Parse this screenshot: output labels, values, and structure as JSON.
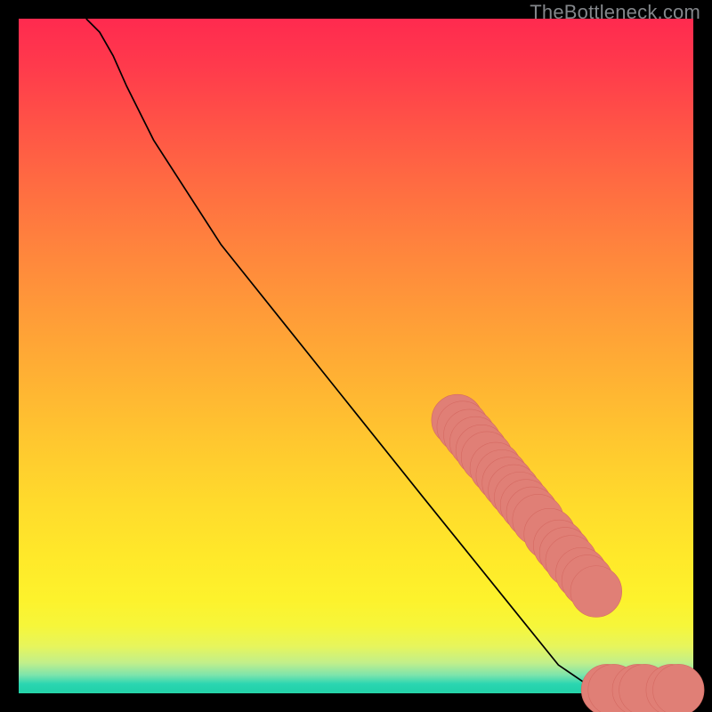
{
  "watermark": "TheBottleneck.com",
  "colors": {
    "curve_stroke": "#000000",
    "marker_fill": "#e07f76",
    "marker_stroke": "#d56a62"
  },
  "chart_data": {
    "type": "line",
    "title": "",
    "xlabel": "",
    "ylabel": "",
    "xlim": [
      0,
      100
    ],
    "ylim": [
      0,
      100
    ],
    "series": [
      {
        "name": "curve",
        "x": [
          10,
          12,
          14,
          16,
          20,
          30,
          40,
          50,
          60,
          65,
          70,
          75,
          80,
          85,
          87,
          89,
          90.5,
          92,
          94,
          96,
          98,
          99.5
        ],
        "y": [
          100,
          98,
          94.5,
          90,
          82,
          66.5,
          54,
          41.5,
          29,
          22.8,
          16.6,
          10.4,
          4.2,
          0.8,
          0.55,
          0.5,
          0.5,
          0.5,
          0.5,
          0.5,
          0.5,
          0.5
        ]
      }
    ],
    "markers": [
      {
        "x": 65.0,
        "y": 40.5,
        "r": 3.8
      },
      {
        "x": 65.8,
        "y": 39.5,
        "r": 3.8
      },
      {
        "x": 66.8,
        "y": 38.3,
        "r": 3.8
      },
      {
        "x": 67.7,
        "y": 37.2,
        "r": 3.8
      },
      {
        "x": 68.6,
        "y": 36.0,
        "r": 3.8
      },
      {
        "x": 69.4,
        "y": 35.0,
        "r": 3.8
      },
      {
        "x": 70.7,
        "y": 33.4,
        "r": 3.8
      },
      {
        "x": 71.6,
        "y": 32.3,
        "r": 3.8
      },
      {
        "x": 72.5,
        "y": 31.2,
        "r": 3.8
      },
      {
        "x": 73.4,
        "y": 30.1,
        "r": 3.8
      },
      {
        "x": 74.3,
        "y": 29.0,
        "r": 3.8
      },
      {
        "x": 75.2,
        "y": 27.9,
        "r": 3.8
      },
      {
        "x": 76.1,
        "y": 26.8,
        "r": 3.8
      },
      {
        "x": 77.0,
        "y": 25.7,
        "r": 3.8
      },
      {
        "x": 78.7,
        "y": 23.6,
        "r": 3.8
      },
      {
        "x": 80.1,
        "y": 21.9,
        "r": 3.8
      },
      {
        "x": 81.0,
        "y": 20.8,
        "r": 3.8
      },
      {
        "x": 81.9,
        "y": 19.6,
        "r": 3.8
      },
      {
        "x": 83.4,
        "y": 17.8,
        "r": 3.8
      },
      {
        "x": 84.3,
        "y": 16.7,
        "r": 3.8
      },
      {
        "x": 85.6,
        "y": 15.1,
        "r": 3.8
      },
      {
        "x": 87.2,
        "y": 0.5,
        "r": 3.8
      },
      {
        "x": 88.2,
        "y": 0.5,
        "r": 3.8
      },
      {
        "x": 91.8,
        "y": 0.5,
        "r": 3.8
      },
      {
        "x": 92.8,
        "y": 0.5,
        "r": 3.8
      },
      {
        "x": 96.8,
        "y": 0.5,
        "r": 3.8
      },
      {
        "x": 97.8,
        "y": 0.5,
        "r": 3.8
      }
    ]
  }
}
